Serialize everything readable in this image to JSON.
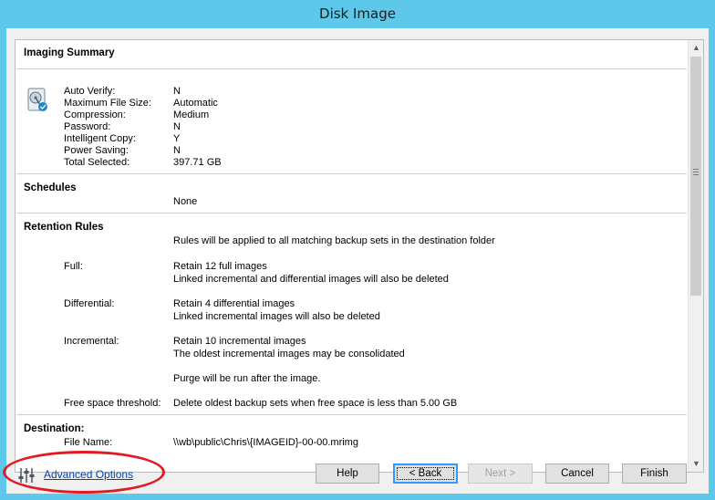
{
  "window": {
    "title": "Disk Image"
  },
  "summary": {
    "title": "Imaging Summary",
    "rows": [
      {
        "label": "Auto Verify:",
        "value": "N"
      },
      {
        "label": "Maximum File Size:",
        "value": "Automatic"
      },
      {
        "label": "Compression:",
        "value": "Medium"
      },
      {
        "label": "Password:",
        "value": "N"
      },
      {
        "label": "Intelligent Copy:",
        "value": "Y"
      },
      {
        "label": "Power Saving:",
        "value": "N"
      },
      {
        "label": "Total Selected:",
        "value": "397.71 GB"
      }
    ]
  },
  "schedules": {
    "title": "Schedules",
    "value": "None"
  },
  "retention": {
    "title": "Retention Rules",
    "intro": "Rules will be applied to all matching backup sets in the destination folder",
    "full_label": "Full:",
    "full_line1": "Retain 12 full images",
    "full_line2": "Linked incremental and differential images will also be deleted",
    "diff_label": "Differential:",
    "diff_line1": "Retain 4 differential images",
    "diff_line2": "Linked incremental images will also be deleted",
    "inc_label": "Incremental:",
    "inc_line1": "Retain 10 incremental images",
    "inc_line2": "The oldest incremental images may be consolidated",
    "purge": "Purge will be run after the image.",
    "threshold_label": "Free space threshold:",
    "threshold_value": "Delete oldest backup sets when free space is less than 5.00 GB"
  },
  "destination": {
    "title": "Destination:",
    "file_label": "File Name:",
    "file_value": "\\\\wb\\public\\Chris\\{IMAGEID}-00-00.mrimg"
  },
  "footer": {
    "advanced_options": "Advanced Options",
    "help": "Help",
    "back": "< Back",
    "next": "Next >",
    "cancel": "Cancel",
    "finish": "Finish"
  },
  "colors": {
    "titlebar": "#5ec8ea",
    "link": "#0645ad",
    "highlight_ellipse": "#e01b22"
  },
  "icons": {
    "disk": "hard-disk-icon",
    "advanced": "sliders-icon",
    "scroll_up": "chevron-up-icon",
    "scroll_down": "chevron-down-icon"
  }
}
